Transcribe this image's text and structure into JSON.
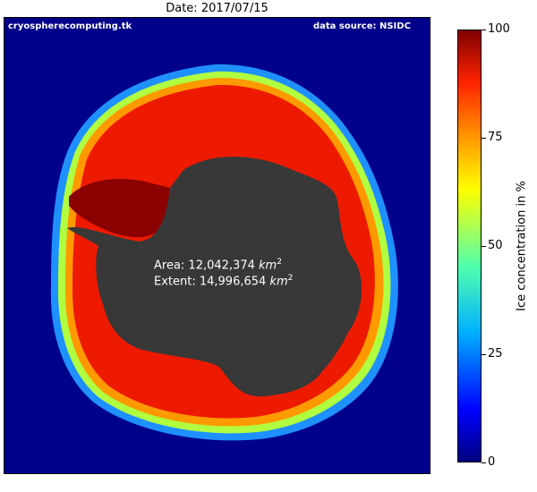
{
  "title": "Date: 2017/07/15",
  "credit_left": "cryospherecomputing.tk",
  "credit_right": "data source: NSIDC",
  "stats": {
    "area_prefix": "Area: 12,042,374 ",
    "extent_prefix": "Extent: 14,996,654 ",
    "unit": "km",
    "unit_power": "2"
  },
  "colorbar": {
    "label": "Ice concentration in %",
    "ticks": [
      "100",
      "75",
      "50",
      "25",
      "0"
    ],
    "range": [
      0,
      100
    ]
  },
  "colors": {
    "ocean": "#00008b",
    "land": "#383838",
    "ice_edge_blue": "#1e90ff",
    "ice_mid": "#ffcc00",
    "ice_high": "#ff2000",
    "ice_max": "#8b0000"
  }
}
